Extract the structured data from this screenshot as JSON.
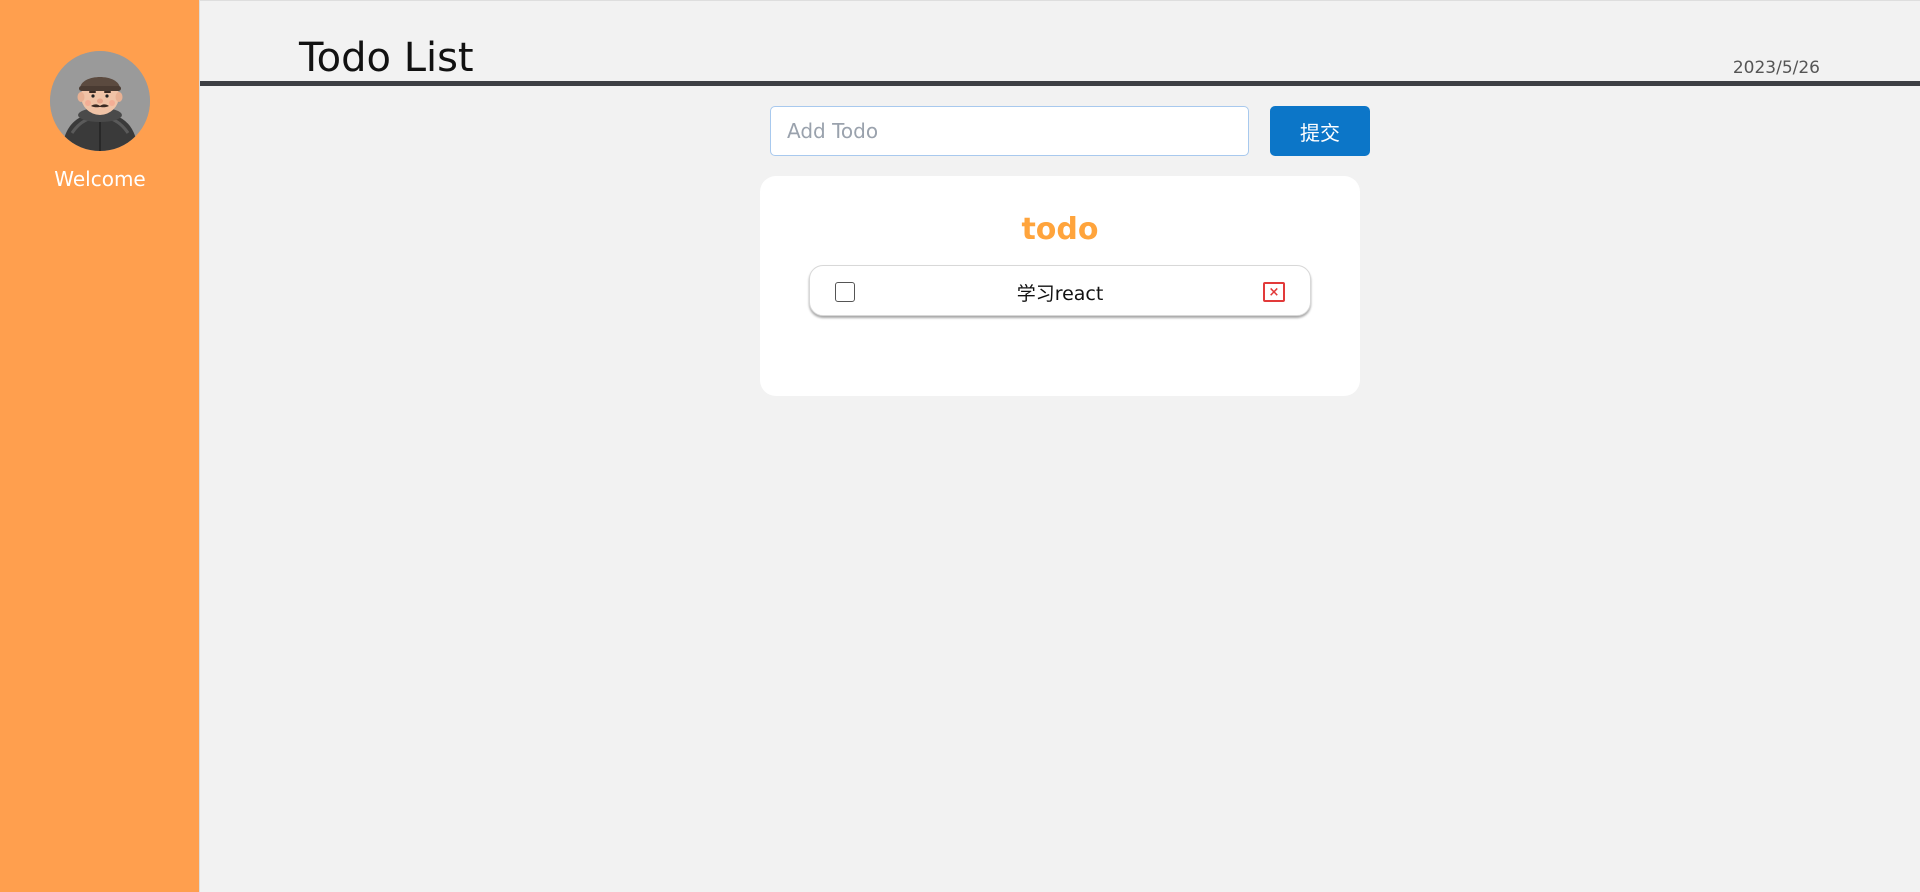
{
  "app": {
    "title": "Todo List",
    "date": "2023/5/26"
  },
  "sidebar": {
    "welcome": "Welcome"
  },
  "form": {
    "placeholder": "Add Todo",
    "value": "",
    "submit_label": "提交"
  },
  "card": {
    "title": "todo",
    "items": [
      {
        "text": "学习react",
        "completed": false,
        "delete_glyph": "×"
      }
    ]
  },
  "colors": {
    "sidebar_bg": "#ff9f4e",
    "accent": "#ffa43c",
    "submit_bg": "#0c76c8",
    "delete": "#e23a3a"
  }
}
